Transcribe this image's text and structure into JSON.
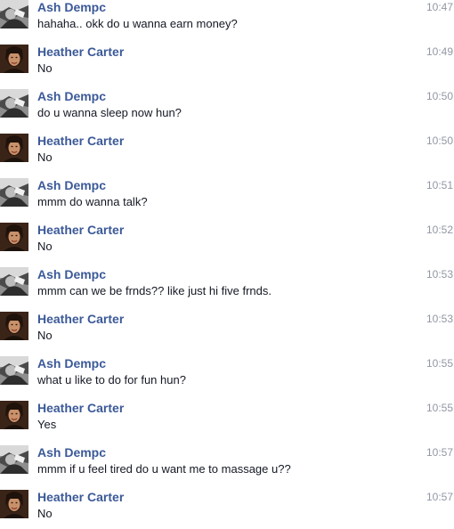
{
  "conversation": {
    "messages": [
      {
        "sender": "Ash Dempc",
        "avatar": "ash",
        "time": "10:47",
        "text": "hahaha.. okk do u wanna earn money?"
      },
      {
        "sender": "Heather Carter",
        "avatar": "heather",
        "time": "10:49",
        "text": "No"
      },
      {
        "sender": "Ash Dempc",
        "avatar": "ash",
        "time": "10:50",
        "text": "do u wanna sleep now hun?"
      },
      {
        "sender": "Heather Carter",
        "avatar": "heather",
        "time": "10:50",
        "text": "No"
      },
      {
        "sender": "Ash Dempc",
        "avatar": "ash",
        "time": "10:51",
        "text": "mmm do wanna talk?"
      },
      {
        "sender": "Heather Carter",
        "avatar": "heather",
        "time": "10:52",
        "text": "No"
      },
      {
        "sender": "Ash Dempc",
        "avatar": "ash",
        "time": "10:53",
        "text": "mmm can we be frnds?? like just hi five frnds."
      },
      {
        "sender": "Heather Carter",
        "avatar": "heather",
        "time": "10:53",
        "text": "No"
      },
      {
        "sender": "Ash Dempc",
        "avatar": "ash",
        "time": "10:55",
        "text": "what u like to do for fun hun?"
      },
      {
        "sender": "Heather Carter",
        "avatar": "heather",
        "time": "10:55",
        "text": "Yes"
      },
      {
        "sender": "Ash Dempc",
        "avatar": "ash",
        "time": "10:57",
        "text": "mmm if u feel tired do u want me to massage u??"
      },
      {
        "sender": "Heather Carter",
        "avatar": "heather",
        "time": "10:57",
        "text": "No"
      }
    ]
  },
  "colors": {
    "sender_name": "#3b5998",
    "timestamp": "#9197a3",
    "message_text": "#141823"
  }
}
